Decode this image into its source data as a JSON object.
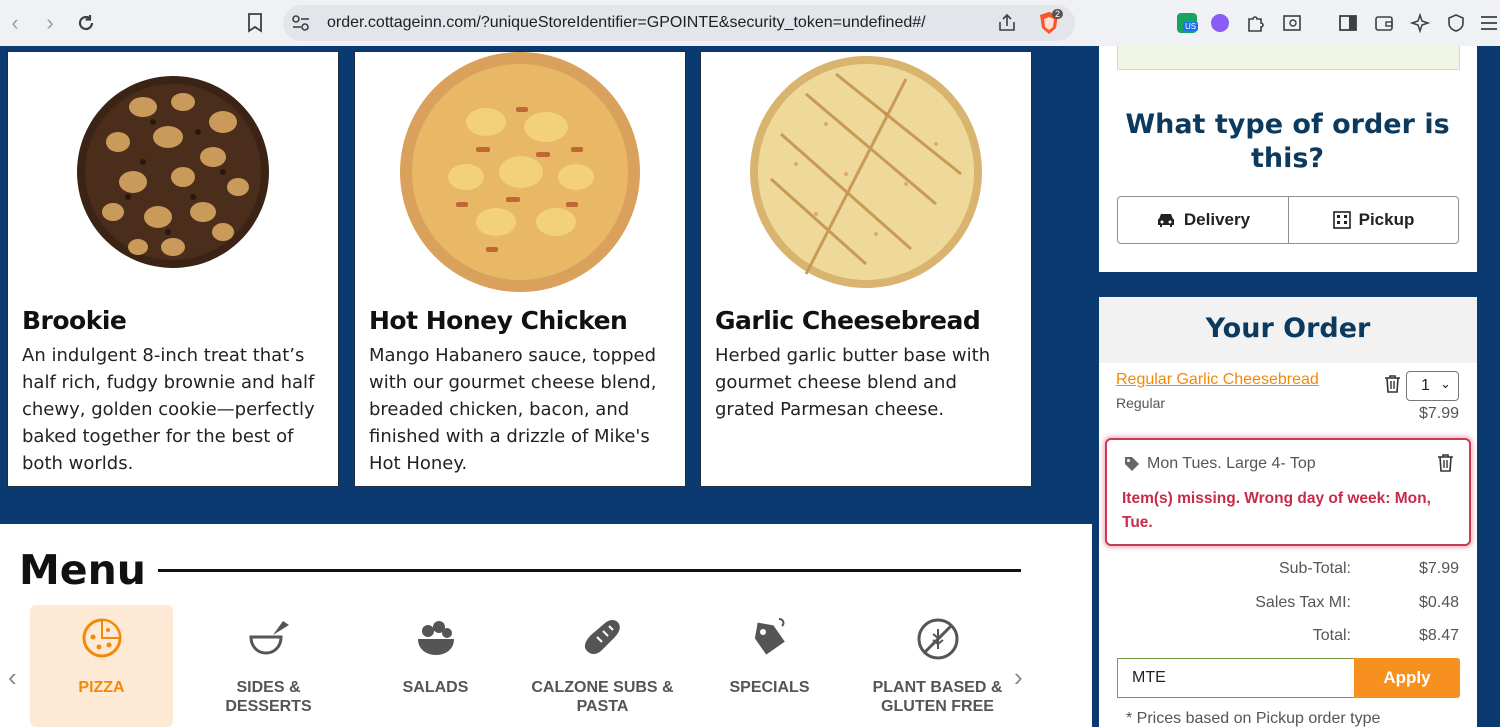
{
  "browser": {
    "url": "order.cottageinn.com/?uniqueStoreIdentifier=GPOINTE&security_token=undefined#/",
    "extension_badge": "US",
    "shield_count": "2"
  },
  "products": [
    {
      "name": "Brookie",
      "description": "An indulgent 8-inch treat that’s half rich, fudgy brownie and half chewy, golden cookie—perfectly baked together for the best of both worlds."
    },
    {
      "name": "Hot Honey Chicken",
      "description": "Mango Habanero sauce, topped with our gourmet cheese blend, breaded chicken, bacon, and finished with a drizzle of Mike's Hot Honey."
    },
    {
      "name": "Garlic Cheesebread",
      "description": "Herbed garlic butter base with gourmet cheese blend and grated Parmesan cheese."
    }
  ],
  "order_type": {
    "question": "What type of order is this?",
    "delivery_label": "Delivery",
    "pickup_label": "Pickup"
  },
  "your_order": {
    "title": "Your Order",
    "item": {
      "name": "Regular Garlic Cheesebread",
      "size": "Regular",
      "quantity": "1",
      "price": "$7.99"
    },
    "coupon": {
      "name": "Mon Tues. Large 4- Top",
      "error": "Item(s) missing. Wrong day of week: Mon, Tue."
    },
    "subtotal_label": "Sub-Total:",
    "subtotal": "$7.99",
    "tax_label": "Sales Tax MI:",
    "tax": "$0.48",
    "total_label": "Total:",
    "total": "$8.47",
    "promo_value": "MTE",
    "apply_label": "Apply",
    "note": "* Prices based on Pickup order type"
  },
  "menu": {
    "title": "Menu",
    "categories": [
      {
        "label": "PIZZA",
        "icon": "pizza-icon",
        "active": true
      },
      {
        "label": "SIDES & DESSERTS",
        "icon": "dessert-bowl-icon"
      },
      {
        "label": "SALADS",
        "icon": "salad-icon"
      },
      {
        "label": "CALZONE SUBS & PASTA",
        "icon": "bread-icon"
      },
      {
        "label": "SPECIALS",
        "icon": "tag-icon"
      },
      {
        "label": "PLANT BASED & GLUTEN FREE",
        "icon": "no-gluten-icon"
      }
    ]
  },
  "colors": {
    "brand_blue": "#0b3a70",
    "accent_orange": "#f7901e",
    "error_red": "#c62c48"
  }
}
